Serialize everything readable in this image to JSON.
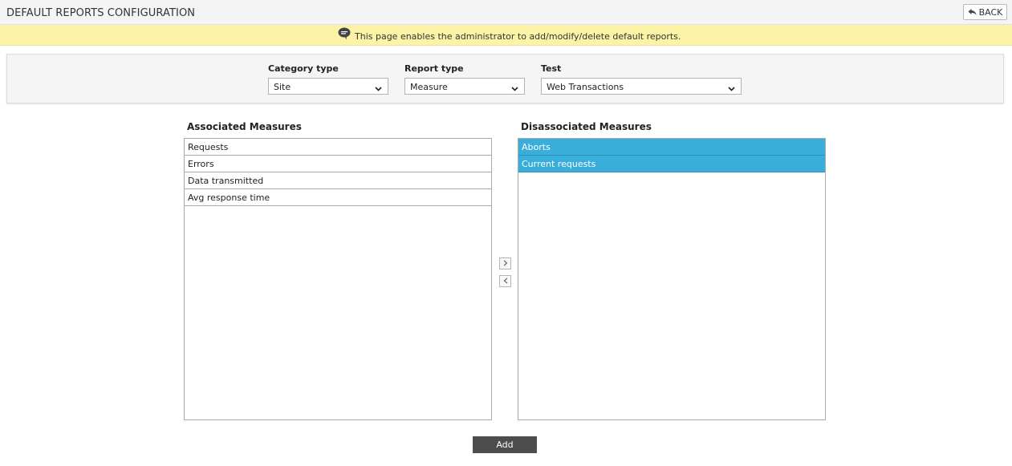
{
  "header": {
    "title": "DEFAULT REPORTS CONFIGURATION",
    "back_label": "BACK"
  },
  "info": {
    "message": "This page enables the administrator to add/modify/delete default reports.",
    "icon": "speech-bubble-icon"
  },
  "filters": {
    "category_type": {
      "label": "Category type",
      "value": "Site"
    },
    "report_type": {
      "label": "Report type",
      "value": "Measure"
    },
    "test": {
      "label": "Test",
      "value": "Web Transactions"
    }
  },
  "associated": {
    "title": "Associated Measures",
    "items": [
      "Requests",
      "Errors",
      "Data transmitted",
      "Avg response time"
    ]
  },
  "disassociated": {
    "title": "Disassociated Measures",
    "items": [
      "Aborts",
      "Current requests"
    ]
  },
  "actions": {
    "add_label": "Add",
    "move_right_icon": "chevron-right-icon",
    "move_left_icon": "chevron-left-icon"
  },
  "colors": {
    "info_bar": "#fdf3a6",
    "selected_item": "#3aaedb",
    "add_button": "#4d4d4d"
  }
}
